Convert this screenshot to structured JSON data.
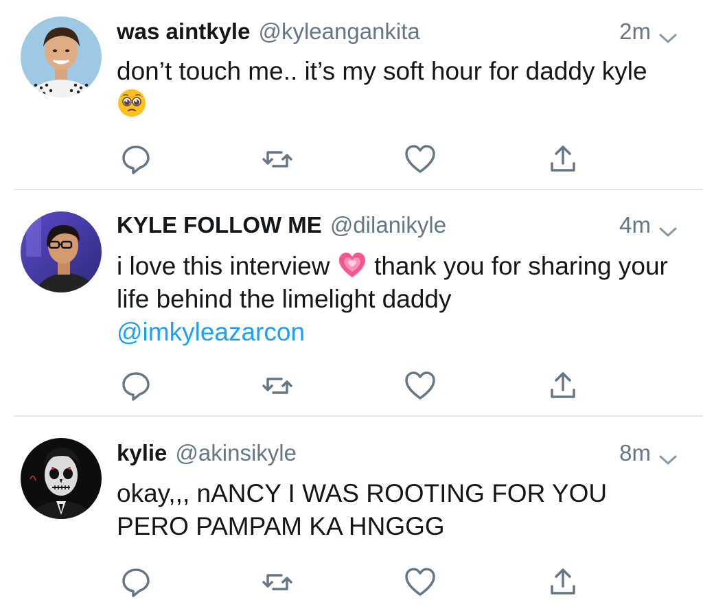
{
  "tweets": [
    {
      "name": "was aintkyle",
      "handle": "@kyleangankita",
      "time": "2m",
      "text": "don’t touch me.. it’s my soft hour for daddy kyle",
      "emoji": "pleading-face-emoji"
    },
    {
      "name": "KYLE FOLLOW ME",
      "handle": "@dilanikyle",
      "time": "4m",
      "text_before": "i love this interview",
      "emoji": "growing-heart-emoji",
      "text_after": "thank you for sharing your life behind the limelight daddy",
      "mention": "@imkyleazarcon"
    },
    {
      "name": "kylie",
      "handle": "@akinsikyle",
      "time": "8m",
      "text": "okay,,, nANCY I WAS ROOTING FOR YOU PERO PAMPAM KA HNGGG"
    }
  ],
  "icons": {
    "reply": "reply-icon",
    "retweet": "retweet-icon",
    "like": "like-icon",
    "share": "share-icon",
    "more": "chevron-down-icon"
  },
  "colors": {
    "text": "#14171a",
    "secondary": "#657786",
    "link": "#1da1f2",
    "icon": "#657786",
    "divider": "#e1e8ed"
  }
}
